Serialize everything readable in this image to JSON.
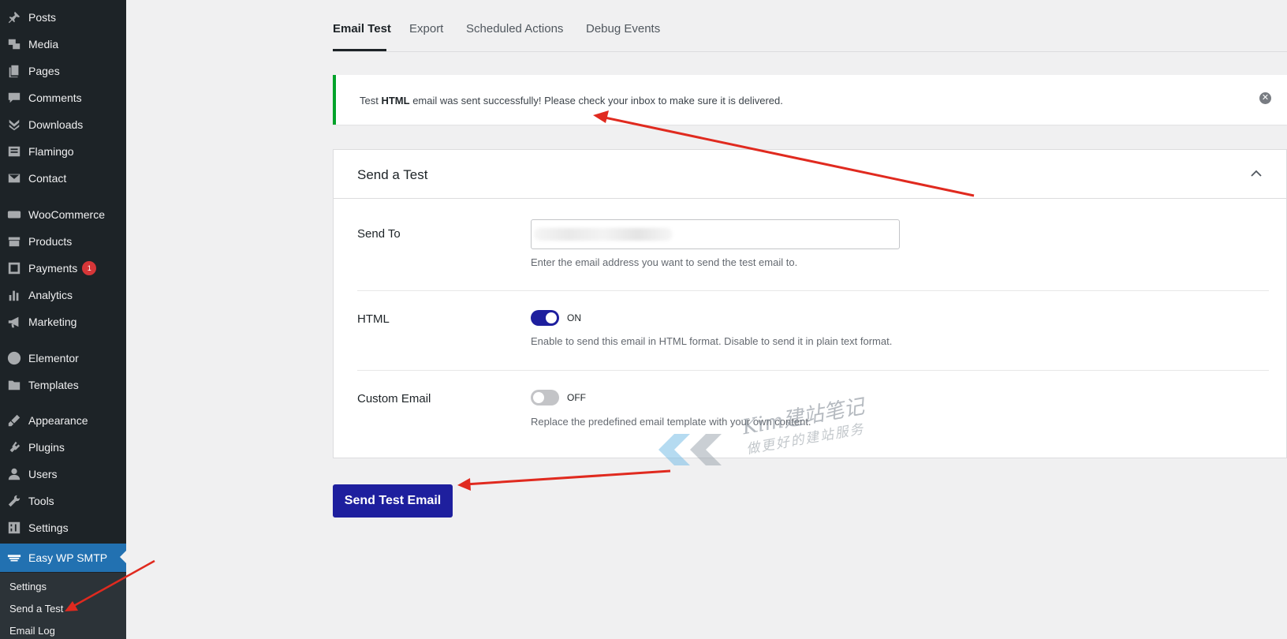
{
  "sidebar": {
    "items": [
      {
        "label": "Posts",
        "icon": "pushpin-icon"
      },
      {
        "label": "Media",
        "icon": "media-icon"
      },
      {
        "label": "Pages",
        "icon": "pages-icon"
      },
      {
        "label": "Comments",
        "icon": "comments-icon"
      },
      {
        "label": "Downloads",
        "icon": "downloads-icon"
      },
      {
        "label": "Flamingo",
        "icon": "flamingo-icon"
      },
      {
        "label": "Contact",
        "icon": "envelope-icon"
      },
      {
        "label": "WooCommerce",
        "icon": "woocommerce-icon"
      },
      {
        "label": "Products",
        "icon": "products-icon"
      },
      {
        "label": "Payments",
        "icon": "payments-icon",
        "badge": "1"
      },
      {
        "label": "Analytics",
        "icon": "analytics-icon"
      },
      {
        "label": "Marketing",
        "icon": "megaphone-icon"
      },
      {
        "label": "Elementor",
        "icon": "elementor-icon"
      },
      {
        "label": "Templates",
        "icon": "folder-icon"
      },
      {
        "label": "Appearance",
        "icon": "brush-icon"
      },
      {
        "label": "Plugins",
        "icon": "plugin-icon"
      },
      {
        "label": "Users",
        "icon": "user-icon"
      },
      {
        "label": "Tools",
        "icon": "wrench-icon"
      },
      {
        "label": "Settings",
        "icon": "settings-icon"
      },
      {
        "label": "Easy WP SMTP",
        "icon": "smtp-icon",
        "active": true
      }
    ],
    "submenu": [
      "Settings",
      "Send a Test",
      "Email Log"
    ]
  },
  "tabs": [
    "Email Test",
    "Export",
    "Scheduled Actions",
    "Debug Events"
  ],
  "notice": {
    "prefix": "Test ",
    "bold": "HTML",
    "suffix": " email was sent successfully! Please check your inbox to make sure it is delivered.",
    "close_icon": "close-icon"
  },
  "panel": {
    "title": "Send a Test",
    "send_to": {
      "label": "Send To",
      "value": "",
      "help": "Enter the email address you want to send the test email to."
    },
    "html": {
      "label": "HTML",
      "state": "ON",
      "help": "Enable to send this email in HTML format. Disable to send it in plain text format."
    },
    "custom_email": {
      "label": "Custom Email",
      "state": "OFF",
      "help": "Replace the predefined email template with your own content."
    }
  },
  "send_button": "Send Test Email",
  "watermark": {
    "line1": "Kim建站笔记",
    "line2": "做更好的建站服务"
  },
  "colors": {
    "sidebar_bg": "#1d2327",
    "active_menu": "#2271b1",
    "primary_button": "#1e1f9e",
    "notice_success": "#00a32a",
    "badge": "#d63638",
    "annotation_arrow": "#e02a1f"
  }
}
